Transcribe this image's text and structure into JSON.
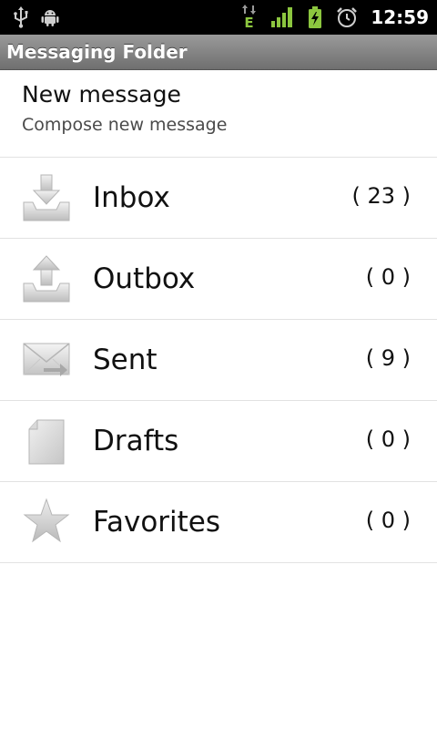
{
  "status_bar": {
    "time": "12:59",
    "network_type": "E",
    "left_icons": [
      "usb-icon",
      "android-debug-icon"
    ],
    "right_icons": [
      "data-transfer-icon",
      "signal-icon",
      "battery-charging-icon",
      "alarm-icon"
    ]
  },
  "title_bar": {
    "title": "Messaging Folder"
  },
  "new_message": {
    "title": "New message",
    "subtitle": "Compose new message"
  },
  "folders": [
    {
      "label": "Inbox",
      "count": "( 23 )",
      "icon": "inbox-icon"
    },
    {
      "label": "Outbox",
      "count": "( 0 )",
      "icon": "outbox-icon"
    },
    {
      "label": "Sent",
      "count": "( 9 )",
      "icon": "sent-icon"
    },
    {
      "label": "Drafts",
      "count": "( 0 )",
      "icon": "drafts-icon"
    },
    {
      "label": "Favorites",
      "count": "( 0 )",
      "icon": "favorites-star-icon"
    }
  ],
  "colors": {
    "status_bar_bg": "#000000",
    "title_bar_bg": "#808080",
    "signal_green": "#8cc63f",
    "divider": "#e2e2e2"
  }
}
